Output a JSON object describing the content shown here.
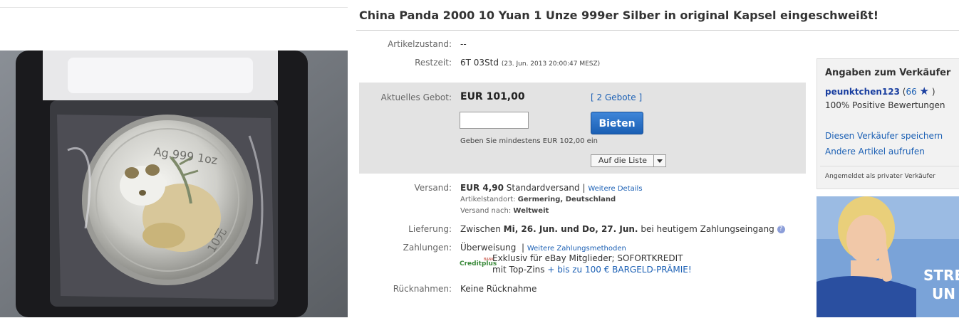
{
  "listing": {
    "title": "China Panda 2000 10 Yuan 1 Unze 999er Silber in original Kapsel eingeschweißt!",
    "condition_label": "Artikelzustand:",
    "condition_value": "--",
    "time_label": "Restzeit:",
    "time_value": "6T 03Std",
    "time_end": "(23. Jun. 2013  20:00:47 MESZ)"
  },
  "bid": {
    "label": "Aktuelles Gebot:",
    "price": "EUR 101,00",
    "bids_open": "[",
    "bids_link": "2 Gebote",
    "bids_close": "]",
    "input_value": "",
    "button": "Bieten",
    "hint": "Geben Sie mindestens EUR 102,00 ein",
    "watch_button": "Auf die Liste"
  },
  "shipping": {
    "label": "Versand:",
    "cost": "EUR 4,90",
    "method": "Standardversand |",
    "details_link": "Weitere Details",
    "location_label": "Artikelstandort:",
    "location": "Germering, Deutschland",
    "ships_to_label": "Versand nach:",
    "ships_to": "Weltweit"
  },
  "delivery": {
    "label": "Lieferung:",
    "prefix": "Zwischen",
    "dates": "Mi, 26. Jun. und Do, 27. Jun.",
    "suffix": "bei heutigem Zahlungseingang"
  },
  "payment": {
    "label": "Zahlungen:",
    "method": "Überweisung",
    "sep": "|",
    "more_link": "Weitere Zahlungsmethoden",
    "creditplus_logo": "Creditplus",
    "creditplus_bank": "BANK",
    "credit_line1": "Exklusiv für eBay Mitglieder; SOFORTKREDIT",
    "credit_line2_prefix": "mit Top-Zins",
    "credit_line2_link": "+ bis zu 100 € BARGELD-PRÄMIE!"
  },
  "returns": {
    "label": "Rücknahmen:",
    "value": "Keine Rücknahme"
  },
  "seller": {
    "heading": "Angaben zum Verkäufer",
    "name": "peunktchen123",
    "score_open": "(",
    "score": "66",
    "score_close": ")",
    "positive": "100% Positive Bewertungen",
    "save_link": "Diesen Verkäufer speichern",
    "other_link": "Andere Artikel aufrufen",
    "note": "Angemeldet als privater Verkäufer"
  },
  "ad": {
    "text1": "STRE",
    "text2": "UN"
  },
  "photo": {
    "coin_text": "Ag.999 1oz",
    "coin_value": "10元"
  },
  "colors": {
    "link": "#1a5fb4",
    "bid_box": "#e3e3e3",
    "button": "#1a5fb4"
  }
}
